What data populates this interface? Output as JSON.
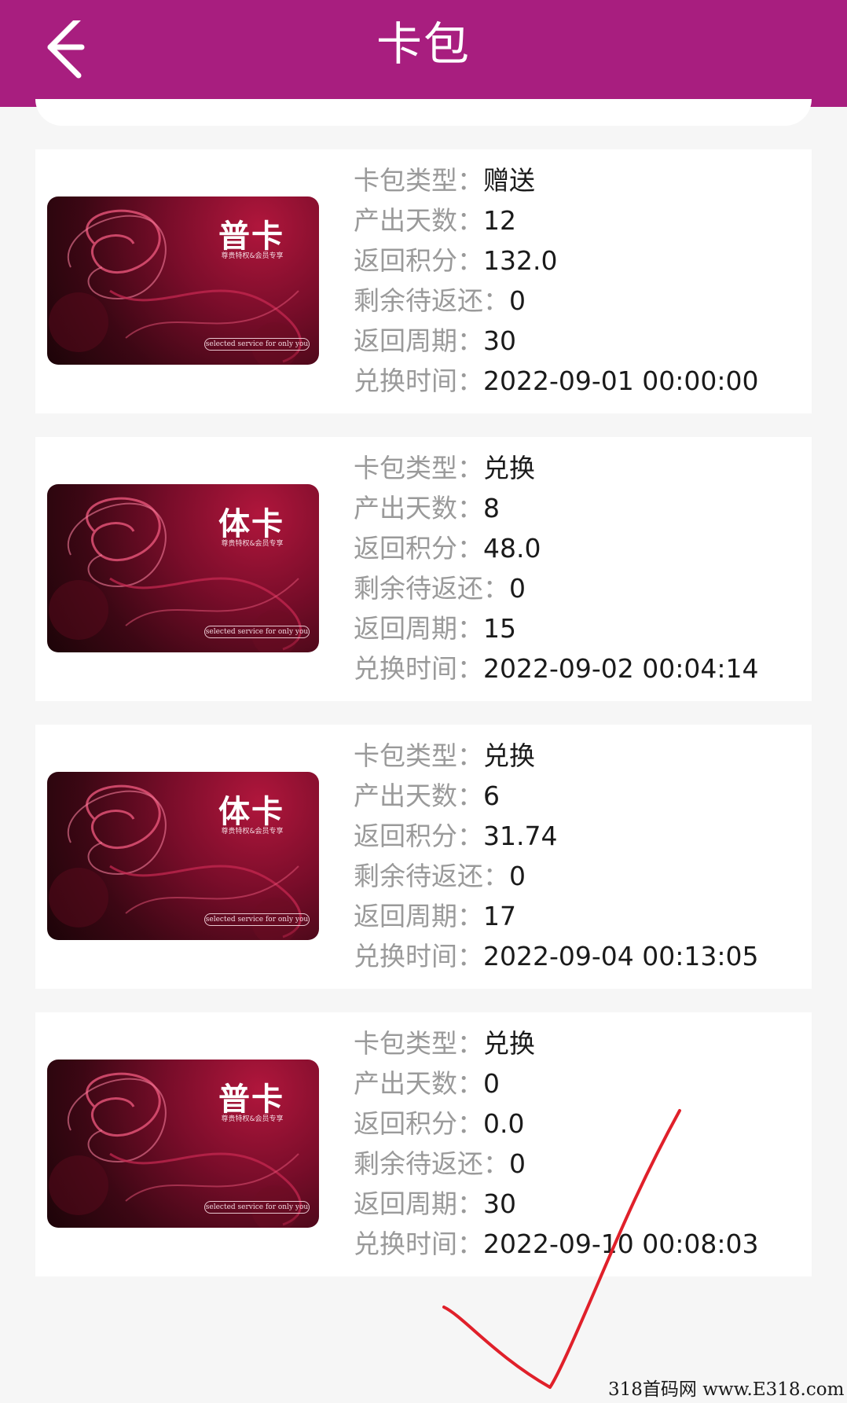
{
  "header": {
    "title": "卡包",
    "back_icon": "arrow-left-icon",
    "background": "#a81e7f"
  },
  "field_labels": {
    "type": "卡包类型：",
    "days": "产出天数：",
    "points": "返回积分：",
    "remaining": "剩余待返还：",
    "cycle": "返回周期：",
    "time": "兑换时间："
  },
  "cards": [
    {
      "card_name": "普卡",
      "card_subtitle": "尊贵特权&会员专享",
      "card_slogan": "selected service for only you",
      "type": "赠送",
      "days": "12",
      "points": "132.0",
      "remaining": "0",
      "cycle": "30",
      "time": "2022-09-01 00:00:00"
    },
    {
      "card_name": "体卡",
      "card_subtitle": "尊贵特权&会员专享",
      "card_slogan": "selected service for only you",
      "type": "兑换",
      "days": "8",
      "points": "48.0",
      "remaining": "0",
      "cycle": "15",
      "time": "2022-09-02 00:04:14"
    },
    {
      "card_name": "体卡",
      "card_subtitle": "尊贵特权&会员专享",
      "card_slogan": "selected service for only you",
      "type": "兑换",
      "days": "6",
      "points": "31.74",
      "remaining": "0",
      "cycle": "17",
      "time": "2022-09-04 00:13:05"
    },
    {
      "card_name": "普卡",
      "card_subtitle": "尊贵特权&会员专享",
      "card_slogan": "selected service for only you",
      "type": "兑换",
      "days": "0",
      "points": "0.0",
      "remaining": "0",
      "cycle": "30",
      "time": "2022-09-10 00:08:03"
    }
  ],
  "watermark": "318首码网 www.E318.com",
  "annotation_icon": "red-checkmark-icon",
  "annotation_color": "#e0202a"
}
